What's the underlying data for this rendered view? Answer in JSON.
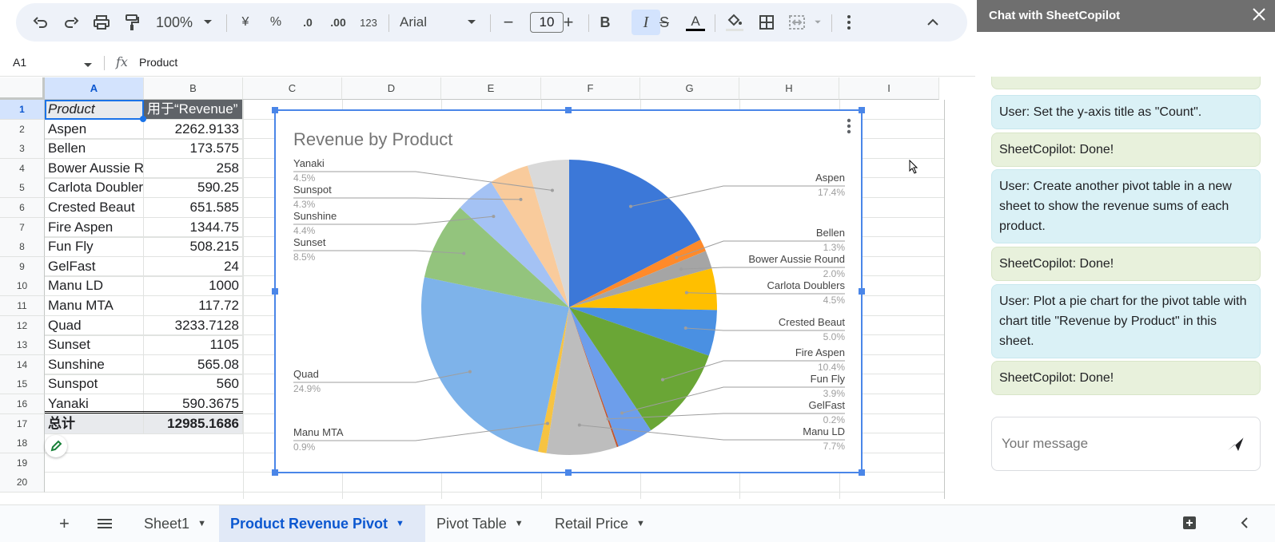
{
  "toolbar": {
    "zoom": "100%",
    "currency": "¥",
    "percent": "%",
    "dec_decrease": ".0",
    "dec_increase": ".00",
    "number_format": "123",
    "font": "Arial",
    "font_size": "10"
  },
  "formula_bar": {
    "cell_ref": "A1",
    "fx": "fx",
    "value": "Product"
  },
  "columns": [
    "A",
    "B",
    "C",
    "D",
    "E",
    "F",
    "G",
    "H",
    "I"
  ],
  "rows": [
    "1",
    "2",
    "3",
    "4",
    "5",
    "6",
    "7",
    "8",
    "9",
    "10",
    "11",
    "12",
    "13",
    "14",
    "15",
    "16",
    "17",
    "18",
    "19",
    "20"
  ],
  "table": {
    "header": [
      "Product",
      "用于“Revenue”"
    ],
    "rows": [
      [
        "Aspen",
        "2262.9133"
      ],
      [
        "Bellen",
        "173.575"
      ],
      [
        "Bower Aussie R",
        "258"
      ],
      [
        "Carlota Doublers",
        "590.25"
      ],
      [
        "Crested Beaut",
        "651.585"
      ],
      [
        "Fire Aspen",
        "1344.75"
      ],
      [
        "Fun Fly",
        "508.215"
      ],
      [
        "GelFast",
        "24"
      ],
      [
        "Manu LD",
        "1000"
      ],
      [
        "Manu MTA",
        "117.72"
      ],
      [
        "Quad",
        "3233.7128"
      ],
      [
        "Sunset",
        "1105"
      ],
      [
        "Sunshine",
        "565.08"
      ],
      [
        "Sunspot",
        "560"
      ],
      [
        "Yanaki",
        "590.3675"
      ]
    ],
    "total": [
      "总计",
      "12985.1686"
    ]
  },
  "chart_data": {
    "type": "pie",
    "title": "Revenue by Product",
    "slices": [
      {
        "label": "Aspen",
        "value": 2262.9133,
        "pct": "17.4%",
        "color": "#3c78d8"
      },
      {
        "label": "Bellen",
        "value": 173.575,
        "pct": "1.3%",
        "color": "#ff8a2a"
      },
      {
        "label": "Bower Aussie Round",
        "value": 258,
        "pct": "2.0%",
        "color": "#a5a5a5"
      },
      {
        "label": "Carlota Doublers",
        "value": 590.25,
        "pct": "4.5%",
        "color": "#ffbf00"
      },
      {
        "label": "Crested Beaut",
        "value": 651.585,
        "pct": "5.0%",
        "color": "#4a90e2"
      },
      {
        "label": "Fire Aspen",
        "value": 1344.75,
        "pct": "10.4%",
        "color": "#6aa636"
      },
      {
        "label": "Fun Fly",
        "value": 508.215,
        "pct": "3.9%",
        "color": "#6d9eeb"
      },
      {
        "label": "GelFast",
        "value": 24,
        "pct": "0.2%",
        "color": "#c1562f"
      },
      {
        "label": "Manu LD",
        "value": 1000,
        "pct": "7.7%",
        "color": "#bdbdbd"
      },
      {
        "label": "Manu MTA",
        "value": 117.72,
        "pct": "0.9%",
        "color": "#f6c342"
      },
      {
        "label": "Quad",
        "value": 3233.7128,
        "pct": "24.9%",
        "color": "#7eb3ea"
      },
      {
        "label": "Sunset",
        "value": 1105,
        "pct": "8.5%",
        "color": "#93c47d"
      },
      {
        "label": "Sunshine",
        "value": 565.08,
        "pct": "4.4%",
        "color": "#a4c2f4"
      },
      {
        "label": "Sunspot",
        "value": 560,
        "pct": "4.3%",
        "color": "#f9cb9c"
      },
      {
        "label": "Yanaki",
        "value": 590.3675,
        "pct": "4.5%",
        "color": "#d9d9d9"
      }
    ]
  },
  "tabs": [
    "Sheet1",
    "Product Revenue Pivot",
    "Pivot Table",
    "Retail Price"
  ],
  "chat": {
    "title": "Chat with SheetCopilot",
    "messages": [
      {
        "role": "user",
        "text": "User: Set the y-axis title as \"Count\"."
      },
      {
        "role": "bot",
        "text": "SheetCopilot: Done!"
      },
      {
        "role": "user",
        "text": "User: Create another pivot table in a new sheet to show the revenue sums of each product."
      },
      {
        "role": "bot",
        "text": "SheetCopilot: Done!"
      },
      {
        "role": "user",
        "text": "User: Plot a pie chart for the pivot table with chart title \"Revenue by Product\" in this sheet."
      },
      {
        "role": "bot",
        "text": "SheetCopilot: Done!"
      }
    ],
    "placeholder": "Your message"
  }
}
